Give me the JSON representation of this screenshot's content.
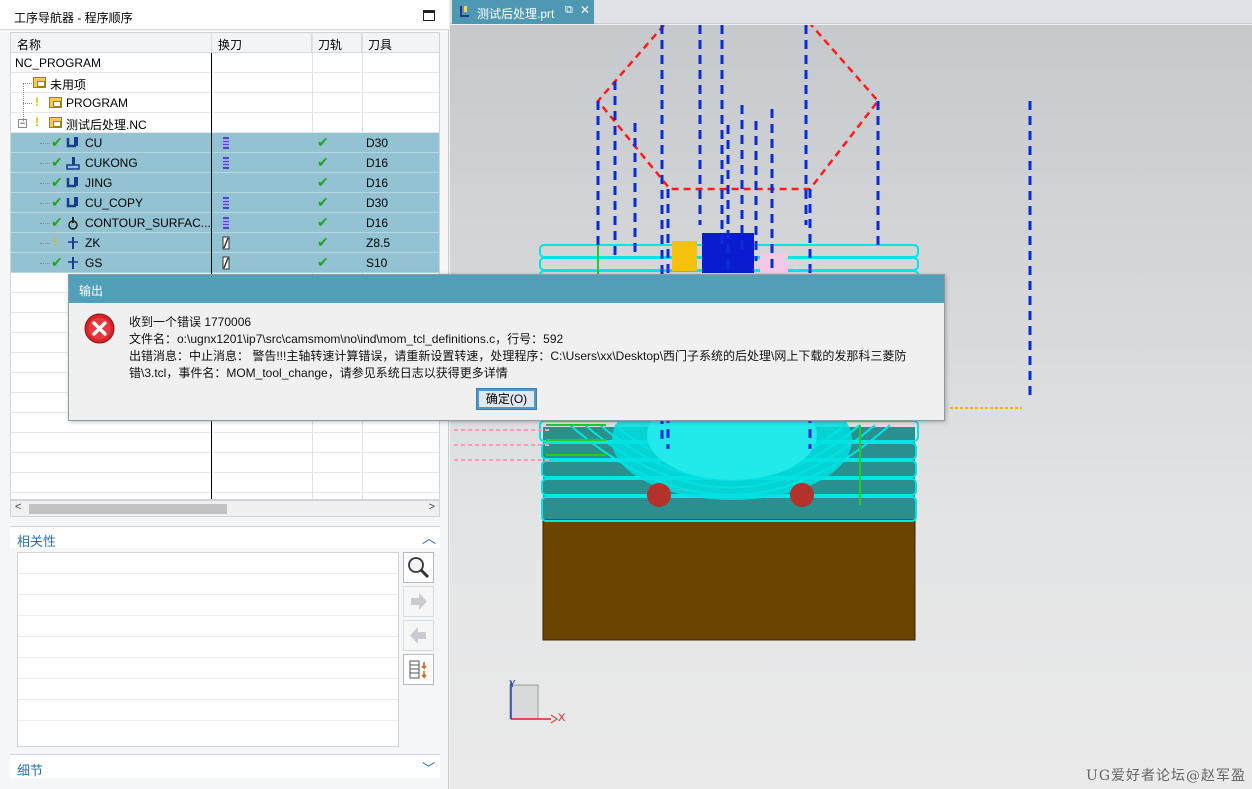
{
  "navigator": {
    "title": "工序导航器 - 程序顺序",
    "columns": [
      "名称",
      "换刀",
      "刀轨",
      "刀具"
    ],
    "rows": [
      {
        "name": "NC_PROGRAM",
        "tool_change": "",
        "path": "",
        "tool": ""
      },
      {
        "name": "未用项",
        "tool_change": "",
        "path": "",
        "tool": ""
      },
      {
        "name": "PROGRAM",
        "tool_change": "",
        "path": "",
        "tool": ""
      },
      {
        "name": "测试后处理.NC",
        "tool_change": "",
        "path": "",
        "tool": ""
      },
      {
        "name": "CU",
        "tool_change": "",
        "path": "✔",
        "tool": "D30"
      },
      {
        "name": "CUKONG",
        "tool_change": "",
        "path": "✔",
        "tool": "D16"
      },
      {
        "name": "JING",
        "tool_change": "",
        "path": "✔",
        "tool": "D16"
      },
      {
        "name": "CU_COPY",
        "tool_change": "",
        "path": "✔",
        "tool": "D30"
      },
      {
        "name": "CONTOUR_SURFAC...",
        "tool_change": "",
        "path": "✔",
        "tool": "D16"
      },
      {
        "name": "ZK",
        "tool_change": "",
        "path": "✔",
        "tool": "Z8.5"
      },
      {
        "name": "GS",
        "tool_change": "",
        "path": "✔",
        "tool": "S10"
      }
    ]
  },
  "relations": {
    "label": "相关性"
  },
  "details": {
    "label": "细节"
  },
  "document_tab": {
    "label": "测试后处理.prt"
  },
  "dialog": {
    "title": "输出",
    "line1": "收到一个错误 1770006",
    "line2": "文件名：o:\\ugnx1201\\ip7\\src\\camsmom\\no\\ind\\mom_tcl_definitions.c，行号：592",
    "line3": "出错消息：中止消息： 警告!!!主轴转速计算错误，请重新设置转速，处理程序：C:\\Users\\xx\\Desktop\\西门子系统的后处理\\网上下载的发那科三菱防",
    "line4": "错\\3.tcl，事件名：MOM_tool_change，请参见系统日志以获得更多详情",
    "ok_label": "确定(O)"
  },
  "axis": {
    "x_label": "X",
    "y_label": "Y"
  },
  "watermark": "UG爱好者论坛@赵军盈"
}
